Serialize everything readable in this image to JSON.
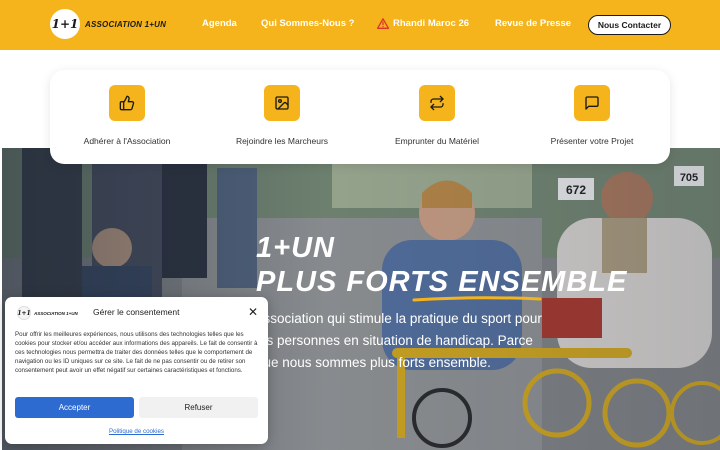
{
  "header": {
    "logo_mark": "1+1",
    "logo_text": "ASSOCIATION 1+UN",
    "nav": [
      {
        "label": "Agenda"
      },
      {
        "label": "Qui Sommes-Nous ?"
      },
      {
        "label": "Rhandi Maroc 26",
        "icon": "warning-icon"
      },
      {
        "label": "Revue de Presse"
      }
    ],
    "contact_label": "Nous Contacter"
  },
  "features": [
    {
      "label": "Adhérer à l'Association",
      "icon": "thumbs-up-icon"
    },
    {
      "label": "Rejoindre les Marcheurs",
      "icon": "image-icon"
    },
    {
      "label": "Emprunter du Matériel",
      "icon": "repeat-icon"
    },
    {
      "label": "Présenter votre Projet",
      "icon": "message-icon"
    }
  ],
  "hero": {
    "title_line1": "1+UN",
    "title_line2": "PLUS FORTS ENSEMBLE",
    "description": "association qui stimule la pratique du sport pour les personnes en situation de handicap. Parce que nous sommes plus forts ensemble.",
    "bibs": [
      "672",
      "705"
    ]
  },
  "consent": {
    "logo_mark": "1+1",
    "logo_text": "ASSOCIATION 1+UN",
    "title": "Gérer le consentement",
    "close_icon": "close-icon",
    "text": "Pour offrir les meilleures expériences, nous utilisons des technologies telles que les cookies pour stocker et/ou accéder aux informations des appareils. Le fait de consentir à ces technologies nous permettra de traiter des données telles que le comportement de navigation ou les ID uniques sur ce site. Le fait de ne pas consentir ou de retirer son consentement peut avoir un effet négatif sur certaines caractéristiques et fonctions.",
    "accept_label": "Accepter",
    "refuse_label": "Refuser",
    "policy_label": "Politique de cookies"
  },
  "colors": {
    "brand_yellow": "#f5b41c",
    "accept_blue": "#2e6bd1"
  }
}
